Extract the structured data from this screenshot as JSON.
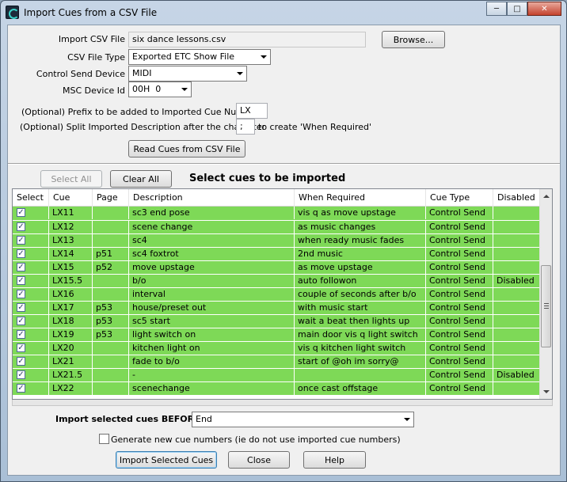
{
  "window": {
    "title": "Import Cues from a CSV File"
  },
  "form": {
    "csv_file_label": "Import CSV File",
    "csv_file_value": "six dance lessons.csv",
    "browse_label": "Browse...",
    "file_type_label": "CSV File Type",
    "file_type_value": "Exported ETC Show File",
    "control_device_label": "Control Send Device",
    "control_device_value": "MIDI",
    "msc_label": "MSC Device Id",
    "msc_value": "00H  0",
    "prefix_label": "(Optional) Prefix to be added to Imported Cue Numbers",
    "prefix_value": "LX",
    "split_label": "(Optional) Split Imported Description after the character",
    "split_value": ";",
    "split_suffix": "to create 'When Required'",
    "read_button": "Read Cues from CSV File"
  },
  "selection": {
    "select_all": "Select All",
    "clear_all": "Clear All",
    "heading": "Select cues to be imported"
  },
  "table": {
    "columns": [
      "Select",
      "Cue",
      "Page",
      "Description",
      "When Required",
      "Cue Type",
      "Disabled"
    ],
    "rows": [
      {
        "checked": true,
        "cue": "LX11",
        "page": "",
        "description": "sc3 end pose",
        "when": "vis q as move upstage",
        "type": "Control Send",
        "disabled": ""
      },
      {
        "checked": true,
        "cue": "LX12",
        "page": "",
        "description": "scene change",
        "when": "as music changes",
        "type": "Control Send",
        "disabled": ""
      },
      {
        "checked": true,
        "cue": "LX13",
        "page": "",
        "description": "sc4",
        "when": "when ready music fades",
        "type": "Control Send",
        "disabled": ""
      },
      {
        "checked": true,
        "cue": "LX14",
        "page": "p51",
        "description": "sc4 foxtrot",
        "when": "2nd music",
        "type": "Control Send",
        "disabled": ""
      },
      {
        "checked": true,
        "cue": "LX15",
        "page": "p52",
        "description": "move upstage",
        "when": "as move upstage",
        "type": "Control Send",
        "disabled": ""
      },
      {
        "checked": true,
        "cue": "LX15.5",
        "page": "",
        "description": "b/o",
        "when": "auto followon",
        "type": "Control Send",
        "disabled": "Disabled"
      },
      {
        "checked": true,
        "cue": "LX16",
        "page": "",
        "description": "interval",
        "when": "couple of seconds after b/o",
        "type": "Control Send",
        "disabled": ""
      },
      {
        "checked": true,
        "cue": "LX17",
        "page": "p53",
        "description": "house/preset out",
        "when": "with music start",
        "type": "Control Send",
        "disabled": ""
      },
      {
        "checked": true,
        "cue": "LX18",
        "page": "p53",
        "description": "sc5 start",
        "when": "wait a beat then lights up",
        "type": "Control Send",
        "disabled": ""
      },
      {
        "checked": true,
        "cue": "LX19",
        "page": "p53",
        "description": "light switch on",
        "when": "main door vis q light switch",
        "type": "Control Send",
        "disabled": ""
      },
      {
        "checked": true,
        "cue": "LX20",
        "page": "",
        "description": "kitchen light on",
        "when": "vis q kitchen light switch",
        "type": "Control Send",
        "disabled": ""
      },
      {
        "checked": true,
        "cue": "LX21",
        "page": "",
        "description": "fade to b/o",
        "when": "start of @oh im sorry@",
        "type": "Control Send",
        "disabled": ""
      },
      {
        "checked": true,
        "cue": "LX21.5",
        "page": "",
        "description": "-",
        "when": "",
        "type": "Control Send",
        "disabled": "Disabled"
      },
      {
        "checked": true,
        "cue": "LX22",
        "page": "",
        "description": "scenechange",
        "when": "once cast offstage",
        "type": "Control Send",
        "disabled": ""
      }
    ]
  },
  "footer": {
    "import_before_label": "Import selected cues BEFORE",
    "import_before_value": "End",
    "generate_label": "Generate new cue numbers (ie do not use imported cue numbers)",
    "generate_checked": false,
    "import_button": "Import Selected Cues",
    "close_button": "Close",
    "help_button": "Help"
  },
  "colors": {
    "row_green": "#7ed957"
  }
}
